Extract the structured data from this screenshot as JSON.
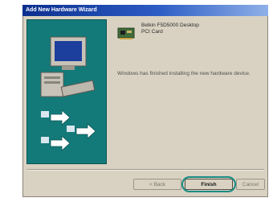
{
  "window": {
    "title": "Add New Hardware Wizard"
  },
  "device": {
    "name": "Belkin F5D5000 Desktop\nPCI Card",
    "icon": "network-card-icon"
  },
  "status": {
    "message": "Windows has finished installing the new hardware device."
  },
  "buttons": {
    "back": "< Back",
    "finish": "Finish",
    "cancel": "Cancel"
  },
  "colors": {
    "title_bar": "#0c2f8e",
    "dialog_face": "#d9d2c2",
    "art_panel": "#137a79",
    "highlight": "#1b8b84"
  }
}
